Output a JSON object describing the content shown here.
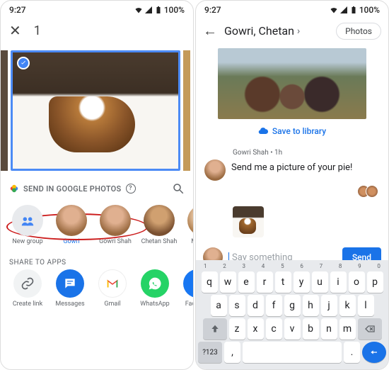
{
  "status": {
    "time": "9:27",
    "battery": "100%"
  },
  "left": {
    "selected_count": "1",
    "send_label": "SEND IN GOOGLE PHOTOS",
    "contacts": [
      {
        "label": "New group"
      },
      {
        "label": "Gowri"
      },
      {
        "label": "Gowri Shah"
      },
      {
        "label": "Chetan Shah"
      },
      {
        "label": "Mark Ch"
      }
    ],
    "share_header": "SHARE TO APPS",
    "apps": [
      {
        "label": "Create link"
      },
      {
        "label": "Messages"
      },
      {
        "label": "Gmail"
      },
      {
        "label": "WhatsApp"
      },
      {
        "label": "Faceboo"
      }
    ]
  },
  "right": {
    "title": "Gowri, Chetan",
    "photos_btn": "Photos",
    "save_label": "Save to library",
    "msg_meta": "Gowri Shah  •  1h",
    "msg_text": "Send me a picture of your pie!",
    "compose_placeholder": "Say something",
    "send_btn": "Send",
    "kbd_nums": [
      "1",
      "2",
      "3",
      "4",
      "5",
      "6",
      "7",
      "8",
      "9",
      "0"
    ],
    "kbd_r1": [
      "q",
      "w",
      "e",
      "r",
      "t",
      "y",
      "u",
      "i",
      "o",
      "p"
    ],
    "kbd_r2": [
      "a",
      "s",
      "d",
      "f",
      "g",
      "h",
      "j",
      "k",
      "l"
    ],
    "kbd_r3": [
      "z",
      "x",
      "c",
      "v",
      "b",
      "n",
      "m"
    ],
    "kbd_sym": "?123",
    "kbd_comma": ",",
    "kbd_period": "."
  }
}
